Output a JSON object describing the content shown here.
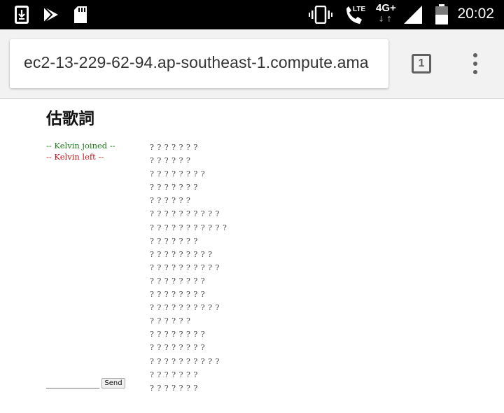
{
  "status_bar": {
    "time": "20:02",
    "network_label": "4G+",
    "lte_label": "LTE",
    "data_arrows": "↓↑",
    "icons": [
      "download-icon",
      "play-store-icon",
      "sd-card-icon",
      "vibrate-icon",
      "phone-lte-icon",
      "signal-icon",
      "battery-icon"
    ]
  },
  "browser": {
    "url": "ec2-13-229-62-94.ap-southeast-1.compute.ama",
    "tab_count": "1"
  },
  "page": {
    "title": "估歌詞",
    "log": [
      {
        "text": "-- Kelvin joined --",
        "type": "joined"
      },
      {
        "text": "-- Kelvin left --",
        "type": "left"
      }
    ],
    "lyrics": [
      "? ? ? ? ? ? ?",
      "? ? ? ? ? ?",
      "? ? ? ? ? ? ? ?",
      "? ? ? ? ? ? ?",
      "? ? ? ? ? ?",
      "? ? ? ? ? ? ? ? ? ?",
      "? ? ? ? ? ? ? ? ? ? ?",
      "? ? ? ? ? ? ?",
      "? ? ? ? ? ? ? ? ?",
      "? ? ? ? ? ? ? ? ? ?",
      "? ? ? ? ? ? ? ?",
      "? ? ? ? ? ? ? ?",
      "? ? ? ? ? ? ? ? ? ?",
      "? ? ? ? ? ?",
      "? ? ? ? ? ? ? ?",
      "? ? ? ? ? ? ? ?",
      "? ? ? ? ? ? ? ? ? ?",
      "? ? ? ? ? ? ?",
      "? ? ? ? ? ? ?"
    ],
    "input_value": "",
    "send_label": "Send"
  },
  "colors": {
    "status_bar_bg": "#000000",
    "toolbar_bg": "#f2f2f2",
    "joined": "#1a7a1a",
    "left": "#c0141a"
  }
}
